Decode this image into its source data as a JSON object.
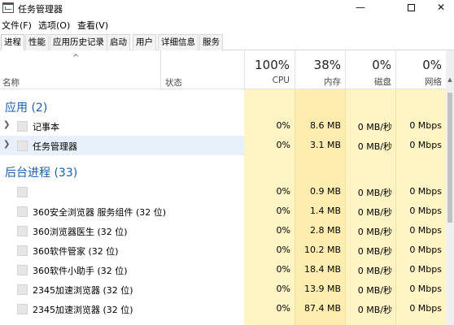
{
  "window": {
    "title": "任务管理器",
    "minimize": "—",
    "close": "✕"
  },
  "menu": [
    "文件(F)",
    "选项(O)",
    "查看(V)"
  ],
  "tabs": [
    "进程",
    "性能",
    "应用历史记录",
    "启动",
    "用户",
    "详细信息",
    "服务"
  ],
  "header": {
    "sort_caret": "^",
    "name": "名称",
    "status": "状态",
    "cpu": {
      "percent": "100%",
      "label": "CPU"
    },
    "memory": {
      "percent": "38%",
      "label": "内存"
    },
    "disk": {
      "percent": "0%",
      "label": "磁盘"
    },
    "network": {
      "percent": "0%",
      "label": "网络"
    }
  },
  "groups": {
    "apps": {
      "title": "应用 (2)",
      "rows": [
        {
          "name": "记事本",
          "cpu": "0%",
          "memory": "8.6 MB",
          "disk": "0 MB/秒",
          "network": "0 Mbps"
        },
        {
          "name": "任务管理器",
          "cpu": "0%",
          "memory": "3.1 MB",
          "disk": "0 MB/秒",
          "network": "0 Mbps"
        }
      ]
    },
    "background": {
      "title": "后台进程 (33)",
      "rows": [
        {
          "name": "",
          "cpu": "0%",
          "memory": "0.9 MB",
          "disk": "0 MB/秒",
          "network": "0 Mbps"
        },
        {
          "name": "360安全浏览器 服务组件 (32 位)",
          "cpu": "0%",
          "memory": "1.4 MB",
          "disk": "0 MB/秒",
          "network": "0 Mbps"
        },
        {
          "name": "360浏览器医生 (32 位)",
          "cpu": "0%",
          "memory": "2.8 MB",
          "disk": "0 MB/秒",
          "network": "0 Mbps"
        },
        {
          "name": "360软件管家 (32 位)",
          "cpu": "0%",
          "memory": "10.2 MB",
          "disk": "0 MB/秒",
          "network": "0 Mbps"
        },
        {
          "name": "360软件小助手 (32 位)",
          "cpu": "0%",
          "memory": "18.4 MB",
          "disk": "0 MB/秒",
          "network": "0 Mbps"
        },
        {
          "name": "2345加速浏览器 (32 位)",
          "cpu": "0%",
          "memory": "13.9 MB",
          "disk": "0 MB/秒",
          "network": "0 Mbps"
        },
        {
          "name": "2345加速浏览器 (32 位)",
          "cpu": "0%",
          "memory": "87.4 MB",
          "disk": "0 MB/秒",
          "network": "0 Mbps"
        }
      ]
    }
  }
}
